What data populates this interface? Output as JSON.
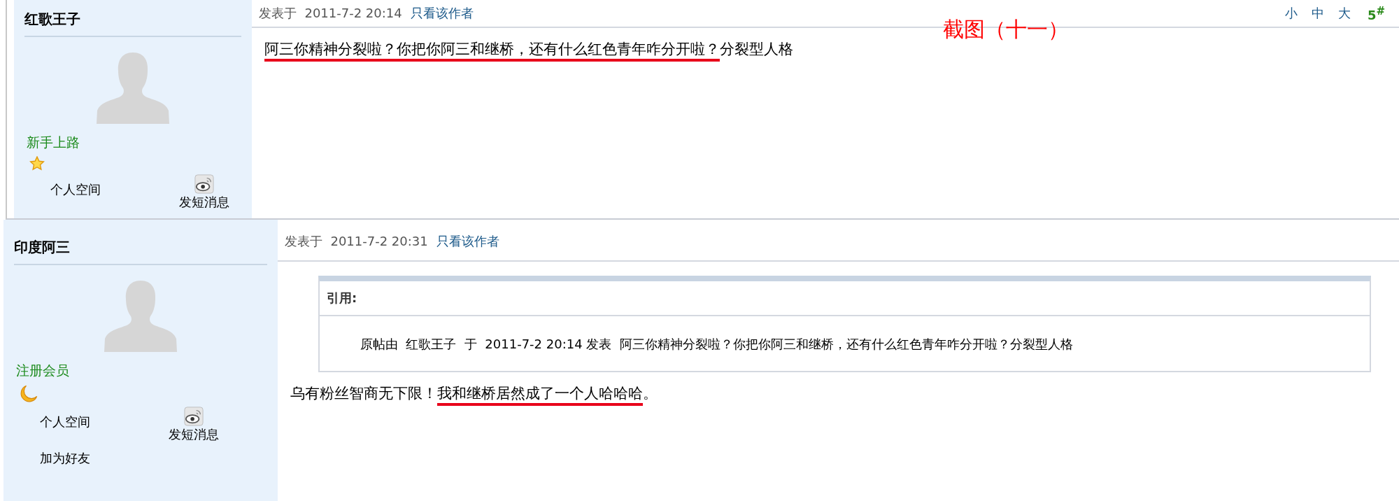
{
  "annotation": "截图（十一）",
  "posts": [
    {
      "author": "红歌王子",
      "rank": "新手上路",
      "rank_icon": {
        "kind": "star"
      },
      "links": {
        "space": "个人空间",
        "message": "发短消息"
      },
      "posted": "发表于  2011-7-2 20:14",
      "author_only": "只看该作者",
      "font_sizes": [
        "小",
        "中",
        "大"
      ],
      "floor": "5$^{#}$",
      "body": [
        {
          "text": "阿三你精神分裂啦？你把你阿三和继桥，还有什么红色青年咋分开啦？",
          "underlined": true
        },
        {
          "text": "分裂型人格",
          "underlined": false
        }
      ]
    },
    {
      "author": "印度阿三",
      "rank": "注册会员",
      "rank_icon": {
        "kind": "moon"
      },
      "links": {
        "space": "个人空间",
        "message": "发短消息",
        "friend": "加为好友"
      },
      "posted": "发表于  2011-7-2 20:31",
      "author_only": "只看该作者",
      "quote": {
        "label": "引用:",
        "text": "原帖由  红歌王子  于  2011-7-2 20:14 发表  阿三你精神分裂啦？你把你阿三和继桥，还有什么红色青年咋分开啦？分裂型人格"
      },
      "body": [
        {
          "text": "乌有粉丝智商无下限！",
          "underlined": false
        },
        {
          "text": "我和继桥居然成了一个人哈哈哈",
          "underlined": true
        },
        {
          "text": "。",
          "underlined": false
        }
      ]
    }
  ]
}
